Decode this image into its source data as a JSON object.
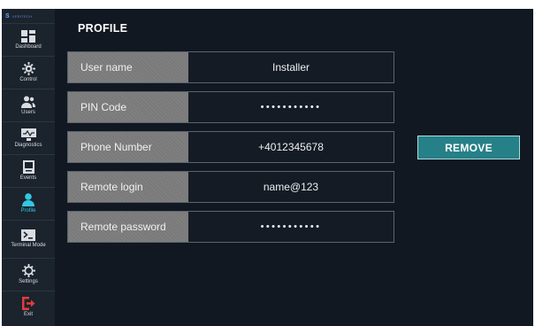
{
  "sidebar": {
    "logo_text": "VERITECH",
    "items": [
      {
        "label": "Dashboard",
        "icon": "dashboard-icon"
      },
      {
        "label": "Control",
        "icon": "gear-cog-icon"
      },
      {
        "label": "Users",
        "icon": "users-icon"
      },
      {
        "label": "Diagnostics",
        "icon": "diagnostics-icon"
      },
      {
        "label": "Events",
        "icon": "events-icon"
      },
      {
        "label": "Profile",
        "icon": "profile-icon",
        "active": true
      },
      {
        "label": "Terminal Mode",
        "icon": "terminal-icon"
      },
      {
        "label": "Settings",
        "icon": "settings-icon"
      },
      {
        "label": "Exit",
        "icon": "exit-icon"
      }
    ]
  },
  "page": {
    "title": "PROFILE"
  },
  "fields": [
    {
      "label": "User name",
      "value": "Installer"
    },
    {
      "label": "PIN Code",
      "value": "•••••••••••"
    },
    {
      "label": "Phone Number",
      "value": "+4012345678"
    },
    {
      "label": "Remote login",
      "value": "name@123"
    },
    {
      "label": "Remote password",
      "value": "•••••••••••"
    }
  ],
  "actions": {
    "remove_label": "REMOVE"
  },
  "colors": {
    "background": "#111821",
    "sidebar": "#1b232d",
    "accent": "#34c6e3",
    "button": "#268087",
    "exit": "#e53b3b"
  }
}
